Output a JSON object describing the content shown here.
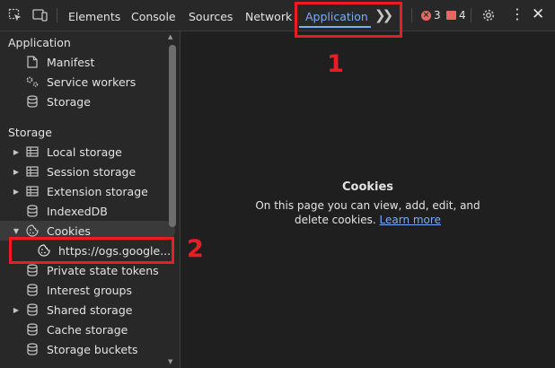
{
  "toolbar": {
    "tabs": [
      {
        "label": "Elements"
      },
      {
        "label": "Console"
      },
      {
        "label": "Sources"
      },
      {
        "label": "Network"
      },
      {
        "label": "Application"
      }
    ],
    "errors_count": "3",
    "warnings_count": "4",
    "active_color": "#7cacf8"
  },
  "sidebar": {
    "application_header": "Application",
    "application_items": [
      {
        "label": "Manifest",
        "icon": "document-icon"
      },
      {
        "label": "Service workers",
        "icon": "gears-icon"
      },
      {
        "label": "Storage",
        "icon": "database-icon"
      }
    ],
    "storage_header": "Storage",
    "storage_items": [
      {
        "label": "Local storage",
        "icon": "table-icon",
        "expandable": true
      },
      {
        "label": "Session storage",
        "icon": "table-icon",
        "expandable": true
      },
      {
        "label": "Extension storage",
        "icon": "table-icon",
        "expandable": true
      },
      {
        "label": "IndexedDB",
        "icon": "database-icon",
        "expandable": false
      },
      {
        "label": "Cookies",
        "icon": "cookie-icon",
        "expanded": true
      },
      {
        "label": "https://ogs.google....",
        "icon": "cookie-icon",
        "child": true,
        "selected": true
      },
      {
        "label": "Private state tokens",
        "icon": "database-icon"
      },
      {
        "label": "Interest groups",
        "icon": "database-icon"
      },
      {
        "label": "Shared storage",
        "icon": "database-icon",
        "expandable": true
      },
      {
        "label": "Cache storage",
        "icon": "database-icon"
      },
      {
        "label": "Storage buckets",
        "icon": "database-icon"
      }
    ]
  },
  "main": {
    "title": "Cookies",
    "message": "On this page you can view, add, edit, and delete cookies.",
    "link": "Learn more"
  },
  "annotations": {
    "one": "1",
    "two": "2",
    "color": "#ec1c24"
  }
}
